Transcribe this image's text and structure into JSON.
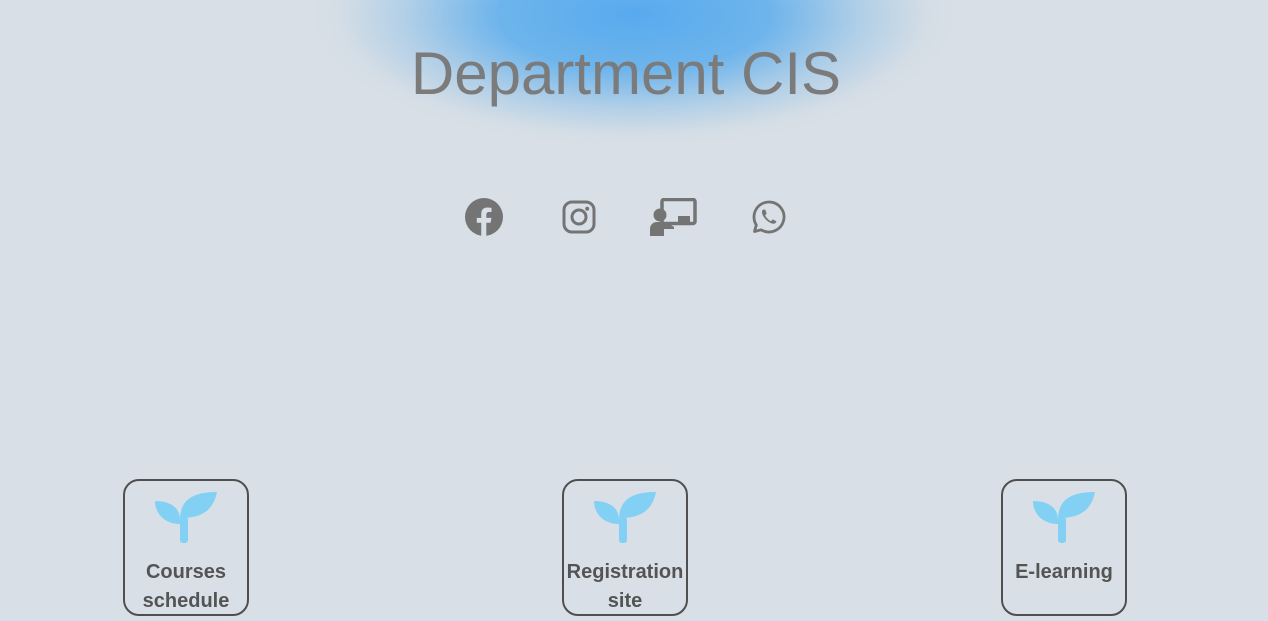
{
  "page": {
    "title": "Department CIS"
  },
  "social_links": [
    {
      "icon": "facebook-icon"
    },
    {
      "icon": "instagram-icon"
    },
    {
      "icon": "chalkboard-teacher-icon"
    },
    {
      "icon": "whatsapp-icon"
    }
  ],
  "cards": [
    {
      "icon": "seedling-icon",
      "label": "Courses schedule"
    },
    {
      "icon": "seedling-icon",
      "label": "Registration site"
    },
    {
      "icon": "seedling-icon",
      "label": "E-learning"
    }
  ],
  "colors": {
    "background": "#d8dfe6",
    "title": "#7b7b7b",
    "icon": "#747474",
    "sprout": "#82d1f5",
    "card_border": "#4f4f4f",
    "card_text": "#545454",
    "glow": "#58aaee"
  }
}
